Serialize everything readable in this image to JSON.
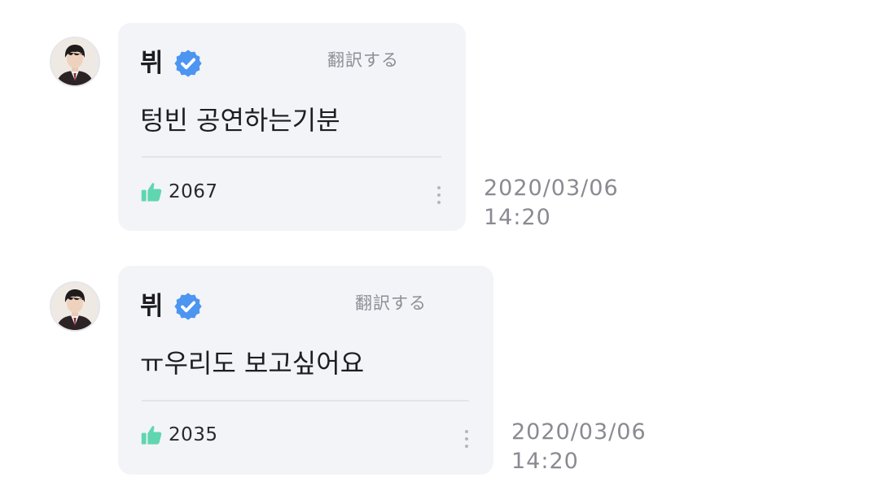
{
  "comments": [
    {
      "author": "뷔",
      "verified_icon": "verified-badge-icon",
      "translate_label": "翻訳する",
      "text": "텅빈 공연하는기분",
      "likes": "2067",
      "like_icon": "thumbs-up-icon",
      "more_icon": "more-vertical-icon",
      "date": "2020/03/06",
      "time": "14:20"
    },
    {
      "author": "뷔",
      "verified_icon": "verified-badge-icon",
      "translate_label": "翻訳する",
      "text": "ㅠ우리도 보고싶어요",
      "likes": "2035",
      "like_icon": "thumbs-up-icon",
      "more_icon": "more-vertical-icon",
      "date": "2020/03/06",
      "time": "14:20"
    }
  ],
  "colors": {
    "bubble_background": "#f3f4f8",
    "verified_blue": "#4c95f0",
    "like_green": "#5fd6b0",
    "timestamp_gray": "#8a8a92"
  }
}
